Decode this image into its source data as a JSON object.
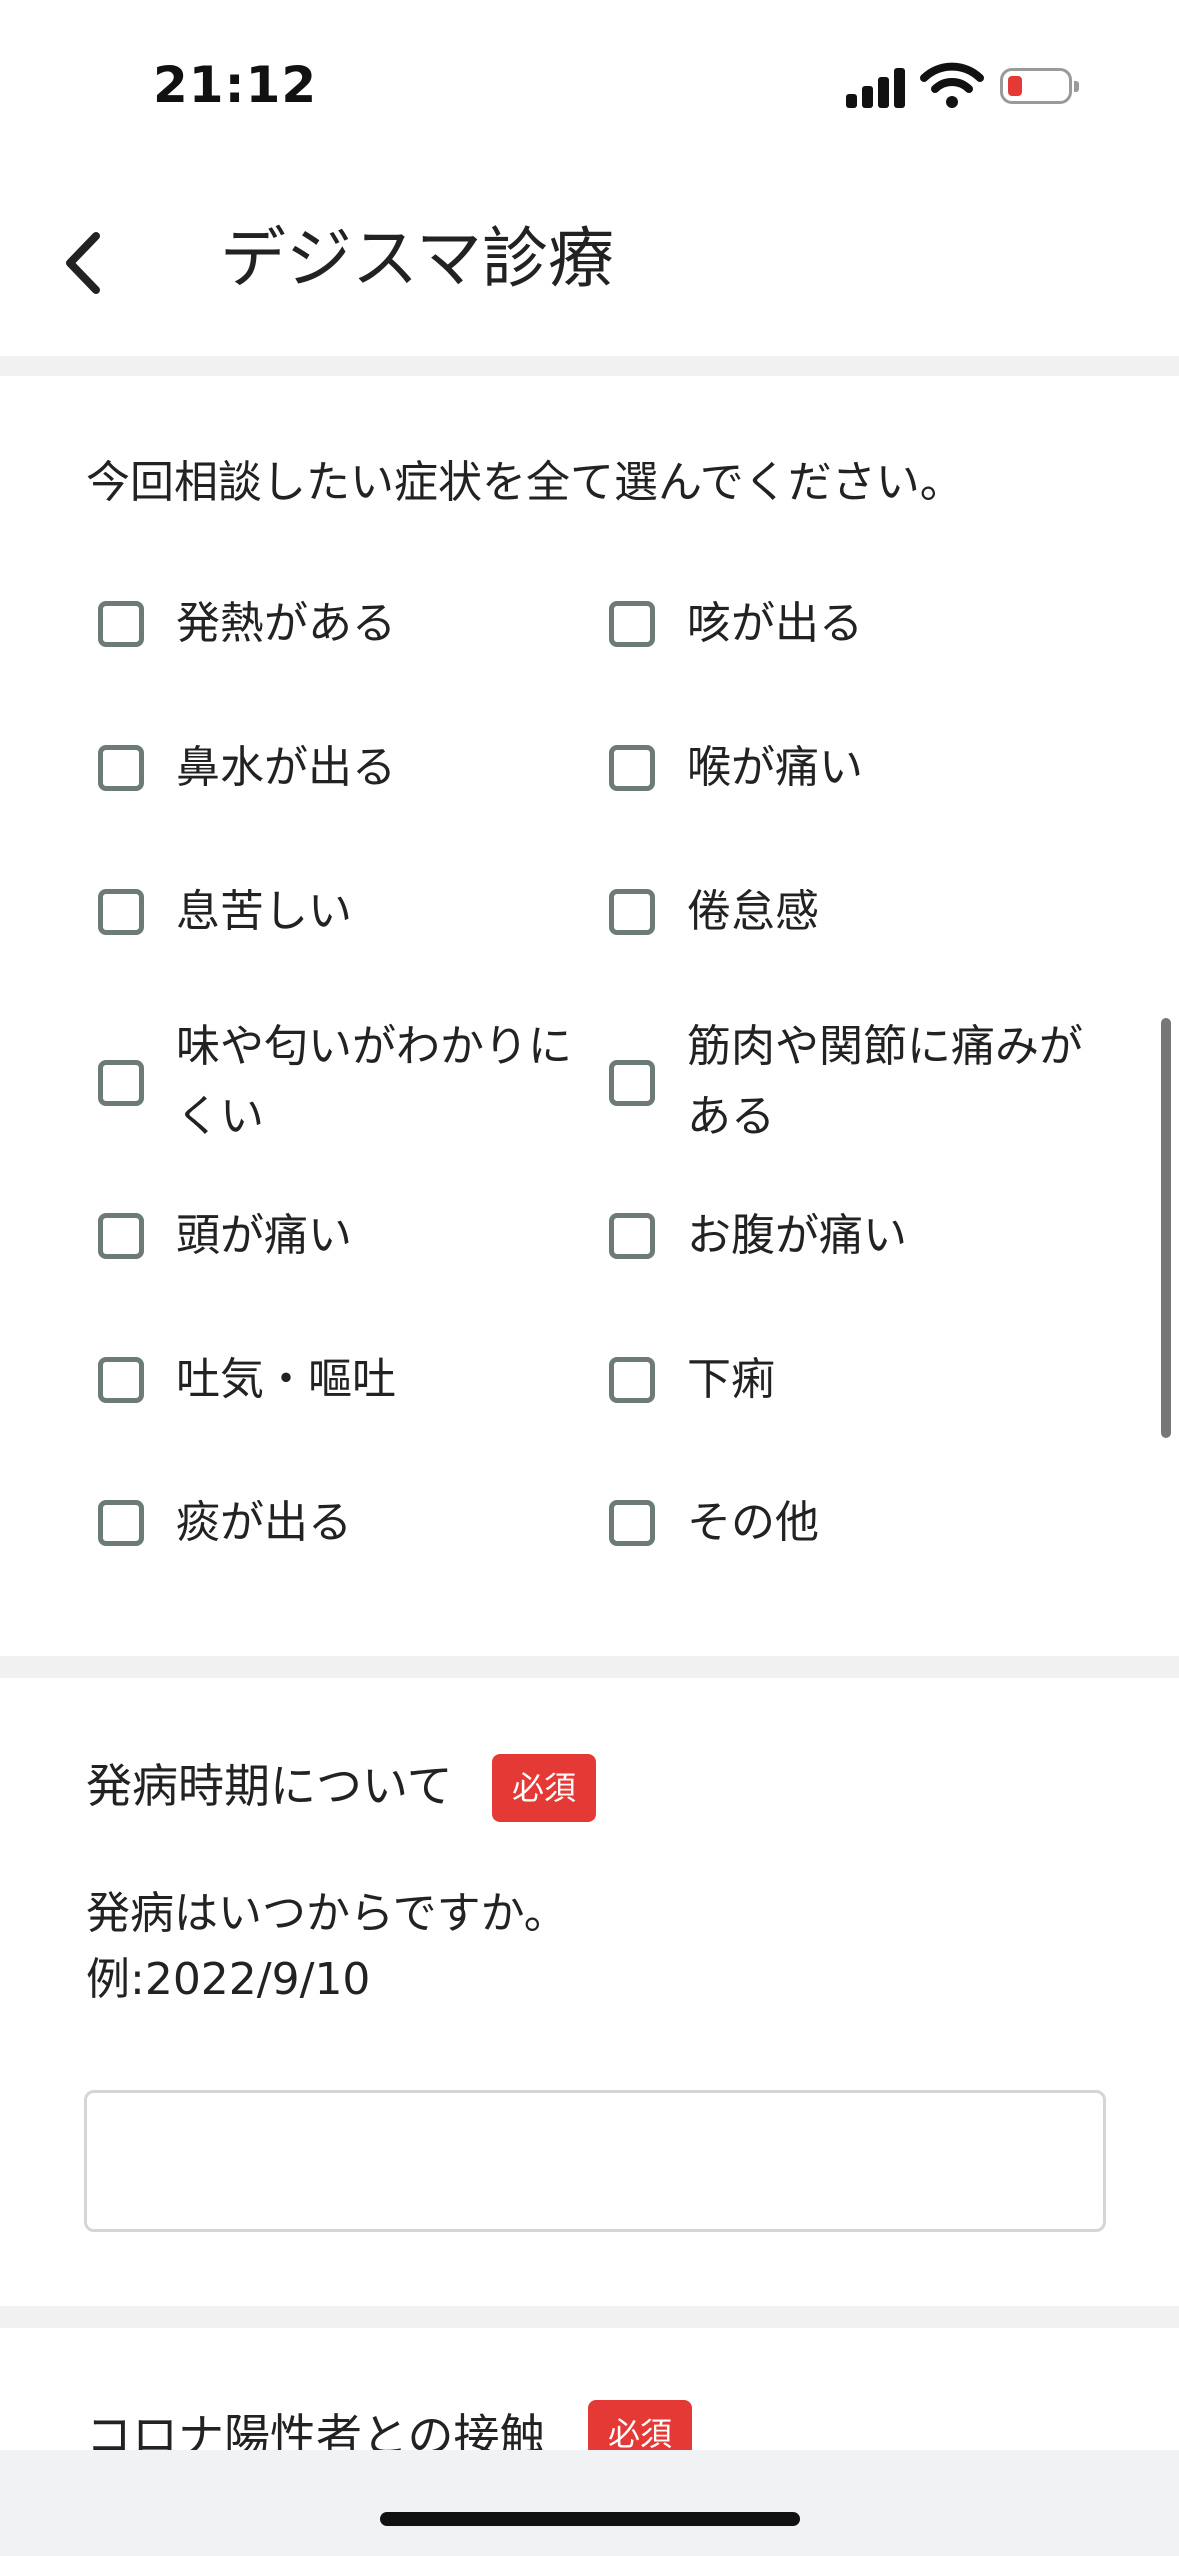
{
  "status_bar": {
    "time": "21:12",
    "battery_level_percent": 10,
    "battery_color": "#e53935"
  },
  "header": {
    "title": "デジスマ診療",
    "back_icon": "chevron-left-icon"
  },
  "symptoms": {
    "prompt": "今回相談したい症状を全て選んでください。",
    "options": [
      {
        "label": "発熱がある",
        "checked": false
      },
      {
        "label": "咳が出る",
        "checked": false
      },
      {
        "label": "鼻水が出る",
        "checked": false
      },
      {
        "label": "喉が痛い",
        "checked": false
      },
      {
        "label": "息苦しい",
        "checked": false
      },
      {
        "label": "倦怠感",
        "checked": false
      },
      {
        "label": "味や匂いがわかりにくい",
        "checked": false
      },
      {
        "label": "筋肉や関節に痛みがある",
        "checked": false
      },
      {
        "label": "頭が痛い",
        "checked": false
      },
      {
        "label": "お腹が痛い",
        "checked": false
      },
      {
        "label": "吐気・嘔吐",
        "checked": false
      },
      {
        "label": "下痢",
        "checked": false
      },
      {
        "label": "痰が出る",
        "checked": false
      },
      {
        "label": "その他",
        "checked": false
      }
    ]
  },
  "onset": {
    "title": "発病時期について",
    "required_badge": "必須",
    "question": "発病はいつからですか。",
    "example": "例:2022/9/10",
    "input_value": "",
    "input_placeholder": ""
  },
  "corona_contact": {
    "title": "コロナ陽性者との接触",
    "required_badge": "必須"
  },
  "colors": {
    "accent_required": "#e53935",
    "checkbox_border": "#6c7a78"
  }
}
